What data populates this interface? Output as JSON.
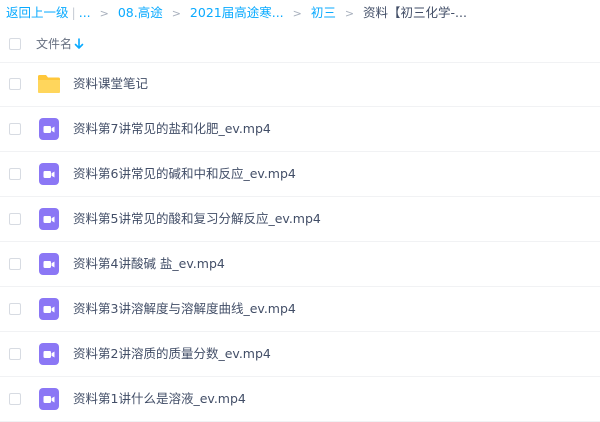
{
  "breadcrumb": {
    "back": "返回上一级",
    "pipe": "|",
    "ellipsis": "...",
    "items": [
      "08.高途",
      "2021届高途寒...",
      "初三"
    ],
    "current": "资料【初三化学-..."
  },
  "header": {
    "column_name": "文件名"
  },
  "files": [
    {
      "name": "资料课堂笔记",
      "type": "folder"
    },
    {
      "name": "资料第7讲常见的盐和化肥_ev.mp4",
      "type": "video"
    },
    {
      "name": "资料第6讲常见的碱和中和反应_ev.mp4",
      "type": "video"
    },
    {
      "name": "资料第5讲常见的酸和复习分解反应_ev.mp4",
      "type": "video"
    },
    {
      "name": "资料第4讲酸碱 盐_ev.mp4",
      "type": "video"
    },
    {
      "name": "资料第3讲溶解度与溶解度曲线_ev.mp4",
      "type": "video"
    },
    {
      "name": "资料第2讲溶质的质量分数_ev.mp4",
      "type": "video"
    },
    {
      "name": "资料第1讲什么是溶液_ev.mp4",
      "type": "video"
    }
  ],
  "colors": {
    "link": "#09aaff",
    "folder": "#ffc73a",
    "video": "#8b77f5"
  }
}
